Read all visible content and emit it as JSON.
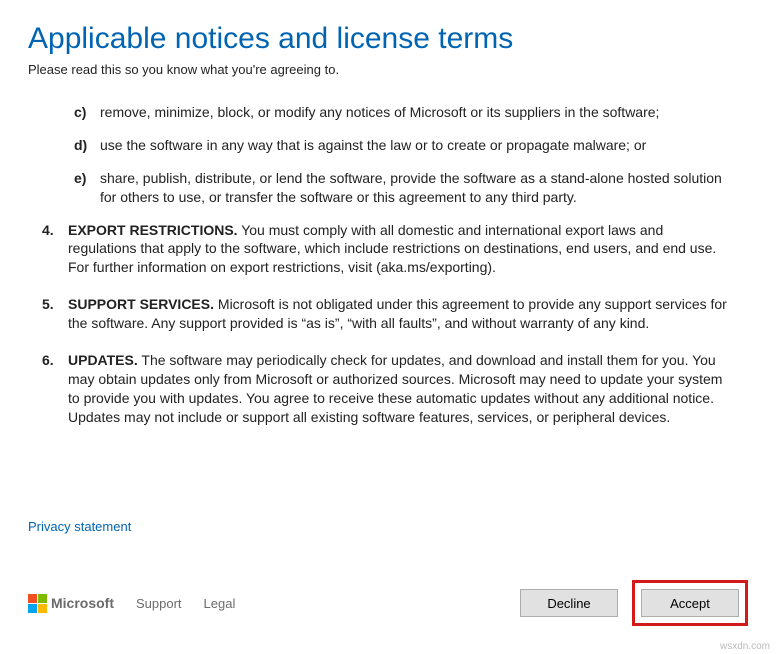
{
  "header": {
    "title": "Applicable notices and license terms",
    "subtitle": "Please read this so you know what you're agreeing to."
  },
  "license": {
    "sub_items": [
      {
        "marker": "c)",
        "text": "remove, minimize, block, or modify any notices of Microsoft or its suppliers in the software;"
      },
      {
        "marker": "d)",
        "text": "use the software in any way that is against the law or to create or propagate malware; or"
      },
      {
        "marker": "e)",
        "text": "share, publish, distribute, or lend the software, provide the software as a stand-alone hosted solution for others to use, or transfer the software or this agreement to any third party."
      }
    ],
    "sections": [
      {
        "num": "4.",
        "title": "EXPORT RESTRICTIONS.",
        "body": " You must comply with all domestic and international export laws and regulations that apply to the software, which include restrictions on destinations, end users, and end use. For further information on export restrictions, visit (aka.ms/exporting)."
      },
      {
        "num": "5.",
        "title": "SUPPORT SERVICES.",
        "body": " Microsoft is not obligated under this agreement to provide any support services for the software. Any support provided is “as is”, “with all faults”, and without warranty of any kind."
      },
      {
        "num": "6.",
        "title": "UPDATES.",
        "body": " The software may periodically check for updates, and download and install them for you. You may obtain updates only from Microsoft or authorized sources. Microsoft may need to update your system to provide you with updates. You agree to receive these automatic updates without any additional notice. Updates may not include or support all existing software features, services, or peripheral devices."
      }
    ]
  },
  "links": {
    "privacy": "Privacy statement",
    "support": "Support",
    "legal": "Legal",
    "microsoft": "Microsoft"
  },
  "buttons": {
    "decline": "Decline",
    "accept": "Accept"
  },
  "watermark": "wsxdn.com"
}
